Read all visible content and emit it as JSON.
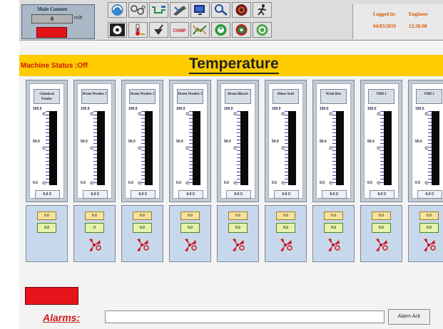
{
  "main_counter": {
    "title": "Main Counter",
    "value": "0",
    "unit": "m/h"
  },
  "toolbar": {
    "row1": [
      {
        "icon": "refresh-icon"
      },
      {
        "icon": "links-icon"
      },
      {
        "icon": "pipe-icon"
      },
      {
        "icon": "tools-icon"
      },
      {
        "icon": "monitor-icon"
      },
      {
        "icon": "search-icon"
      },
      {
        "icon": "reel-icon"
      },
      {
        "icon": "operator-icon"
      }
    ],
    "row2": [
      {
        "icon": "gear-icon"
      },
      {
        "icon": "thermometer-icon"
      },
      {
        "icon": "chemical-icon"
      },
      {
        "icon": "comp-icon",
        "text": "COMP"
      },
      {
        "icon": "chart-icon"
      },
      {
        "icon": "recycle-icon"
      },
      {
        "icon": "process-icon"
      },
      {
        "icon": "cycle-icon"
      }
    ]
  },
  "login": {
    "label": "Logged in:",
    "user": "Engineer",
    "date": "04/03/2019",
    "time": "12:36:00"
  },
  "status": {
    "machine_status": "Machine Status :Off"
  },
  "page": {
    "title": "Temperature"
  },
  "gauges": [
    {
      "label": "Chemical Feeder",
      "max": "100.0",
      "mid": "50.0",
      "min": "0.0",
      "readout": "0.0 C",
      "sp": "0.0",
      "pv": "0.0",
      "fan": false
    },
    {
      "label": "Drum Washer 1",
      "max": "100.0",
      "mid": "50.0",
      "min": "0.0",
      "readout": "0.0 C",
      "sp": "0.0",
      "pv": "0",
      "fan": true
    },
    {
      "label": "Drum Washer 2",
      "max": "100.0",
      "mid": "50.0",
      "min": "0.0",
      "readout": "0.0 C",
      "sp": "0.0",
      "pv": "0.0",
      "fan": true
    },
    {
      "label": "Drum Washer 3",
      "max": "100.0",
      "mid": "50.0",
      "min": "0.0",
      "readout": "0.0 C",
      "sp": "0.0",
      "pv": "0.0",
      "fan": true
    },
    {
      "label": "Drum Bleach",
      "max": "100.0",
      "mid": "50.0",
      "min": "0.0",
      "readout": "0.0 C",
      "sp": "0.0",
      "pv": "0.0",
      "fan": true
    },
    {
      "label": "Rinse Acid",
      "max": "100.0",
      "mid": "50.0",
      "min": "0.0",
      "readout": "0.0 C",
      "sp": "0.0",
      "pv": "0.0",
      "fan": true
    },
    {
      "label": "Wash Box",
      "max": "100.0",
      "mid": "50.0",
      "min": "0.0",
      "readout": "0.0 C",
      "sp": "0.0",
      "pv": "0.0",
      "fan": true
    },
    {
      "label": "VBH 1",
      "max": "100.0",
      "mid": "50.0",
      "min": "0.0",
      "readout": "0.0 C",
      "sp": "0.0",
      "pv": "0.0",
      "fan": true
    },
    {
      "label": "VBH 2",
      "max": "100.0",
      "mid": "50.0",
      "min": "0.0",
      "readout": "0.0 C",
      "sp": "0.0",
      "pv": "0.0",
      "fan": true
    }
  ],
  "alarms": {
    "label": "Alarms:",
    "ack_label": "Alarm Ack"
  },
  "colors": {
    "status_bar": "#ffcc00",
    "alarm_red": "#e5141b",
    "status_text": "#cc1a00"
  }
}
